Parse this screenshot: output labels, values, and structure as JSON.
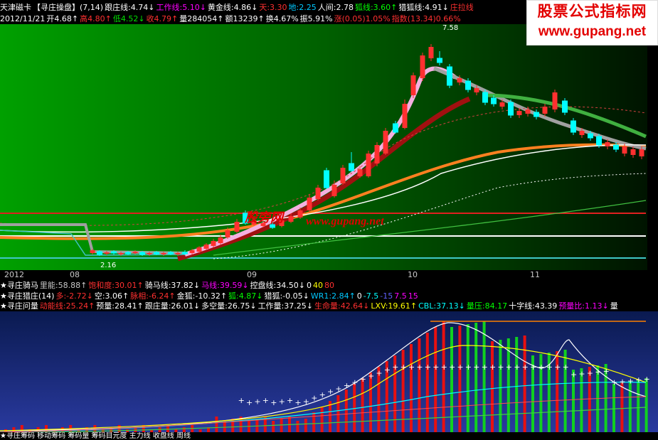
{
  "colors": {
    "red": "#ff3030",
    "green": "#00e000",
    "yellow": "#ffff00",
    "cyan": "#00ffff",
    "magenta": "#ff00ff",
    "white": "#ffffff",
    "orange": "#ff8000",
    "blue": "#6060ff"
  },
  "header": {
    "row1": [
      {
        "t": "天津磁卡",
        "c": "#ffffff"
      },
      {
        "t": "【寻庄操盘】(7,14)",
        "c": "#ffffff"
      },
      {
        "t": "跟庄线:4.74↓",
        "c": "#ffffff"
      },
      {
        "t": "工作线:5.10↓",
        "c": "#ff00ff"
      },
      {
        "t": "黄金线:4.86↓",
        "c": "#ffffff"
      },
      {
        "t": "天:3.30",
        "c": "#ff3030"
      },
      {
        "t": "地:2.25",
        "c": "#00c8ff"
      },
      {
        "t": "人间:2.78",
        "c": "#ffffff"
      },
      {
        "t": "狐线:3.60↑",
        "c": "#00ff00"
      },
      {
        "t": "猎狐线:4.91↓",
        "c": "#ffffff"
      },
      {
        "t": "庄拉线",
        "c": "#ff3030"
      }
    ],
    "row2": [
      {
        "t": "2012/11/21",
        "c": "#ffffff"
      },
      {
        "t": "开4.68↑",
        "c": "#ffffff"
      },
      {
        "t": "高4.80↑",
        "c": "#ff3030"
      },
      {
        "t": "低4.52↓",
        "c": "#00e000"
      },
      {
        "t": "收4.79↑",
        "c": "#ff3030"
      },
      {
        "t": "量284054↑",
        "c": "#ffffff"
      },
      {
        "t": "额13239↑",
        "c": "#ffffff"
      },
      {
        "t": "换4.67%",
        "c": "#ffffff"
      },
      {
        "t": "振5.91%",
        "c": "#ffffff"
      },
      {
        "t": "涨(0.05)1.05%",
        "c": "#ff3030"
      },
      {
        "t": "指数(13.34)0.66%",
        "c": "#ff3030"
      }
    ]
  },
  "watermark": {
    "title": "股票公式指标网",
    "url": "www.gupang.net"
  },
  "center_watermark": {
    "cn": "股旁网",
    "url": "www.gupang.net"
  },
  "price_labels": {
    "high": "7.58",
    "low": "2.16"
  },
  "axis": {
    "labels": [
      "2012",
      "08",
      "09",
      "10",
      "11"
    ]
  },
  "indicators": {
    "row1": [
      {
        "t": "★寻庄骑马",
        "c": "#ffffff"
      },
      {
        "t": "里能:58.88↑",
        "c": "#c8c8c8"
      },
      {
        "t": "饱和度:30.01↑",
        "c": "#ff3030"
      },
      {
        "t": "骑马线:37.82↓",
        "c": "#ffffff"
      },
      {
        "t": "马线:39.59↓",
        "c": "#ff00ff"
      },
      {
        "t": "控盘线:34.50↓",
        "c": "#ffffff"
      },
      {
        "t": "0",
        "c": "#ffffff"
      },
      {
        "t": "40",
        "c": "#ffff00"
      },
      {
        "t": "80",
        "c": "#ff3030"
      }
    ],
    "row2": [
      {
        "t": "★寻庄猎庄(14)",
        "c": "#ffffff"
      },
      {
        "t": "多:-2.72↓",
        "c": "#ff3030"
      },
      {
        "t": "空:3.06↑",
        "c": "#ffffff"
      },
      {
        "t": "脉相:-6.24↑",
        "c": "#ff3030"
      },
      {
        "t": "金狐:-10.32↑",
        "c": "#ffffff"
      },
      {
        "t": "狐:4.87↓",
        "c": "#00ff00"
      },
      {
        "t": "猎狐:-0.05↓",
        "c": "#ffffff"
      },
      {
        "t": "WR1:2.84↑",
        "c": "#00c8ff"
      },
      {
        "t": "0",
        "c": "#ffffff"
      },
      {
        "t": "-7.5",
        "c": "#00ffff"
      },
      {
        "t": "-15",
        "c": "#6060ff"
      },
      {
        "t": "7.5",
        "c": "#ff00ff"
      },
      {
        "t": "15",
        "c": "#ff00ff"
      }
    ],
    "row3": [
      {
        "t": "★寻庄问量",
        "c": "#ffffff"
      },
      {
        "t": "动能线:25.24↑",
        "c": "#ff3030"
      },
      {
        "t": "预量:28.41↑",
        "c": "#ffffff"
      },
      {
        "t": "跟庄量:26.01↓",
        "c": "#ffffff"
      },
      {
        "t": "多空量:26.75↓",
        "c": "#ffffff"
      },
      {
        "t": "工作量:37.25↓",
        "c": "#ffffff"
      },
      {
        "t": "生命量:42.64↓",
        "c": "#ff3030"
      },
      {
        "t": "LXV:19.61↑",
        "c": "#ffff00"
      },
      {
        "t": "CBL:37.13↓",
        "c": "#00ffff"
      },
      {
        "t": "量压:84.17",
        "c": "#00ff00"
      },
      {
        "t": "十字线:43.39",
        "c": "#ffffff"
      },
      {
        "t": "预量比:1.13↓",
        "c": "#ff00ff"
      },
      {
        "t": "量",
        "c": "#ffffff"
      }
    ]
  },
  "bottom": {
    "text": "★寻庄筹码  移动筹码        筹码量           筹码目元度       主力线          收盘线           周线"
  }
}
